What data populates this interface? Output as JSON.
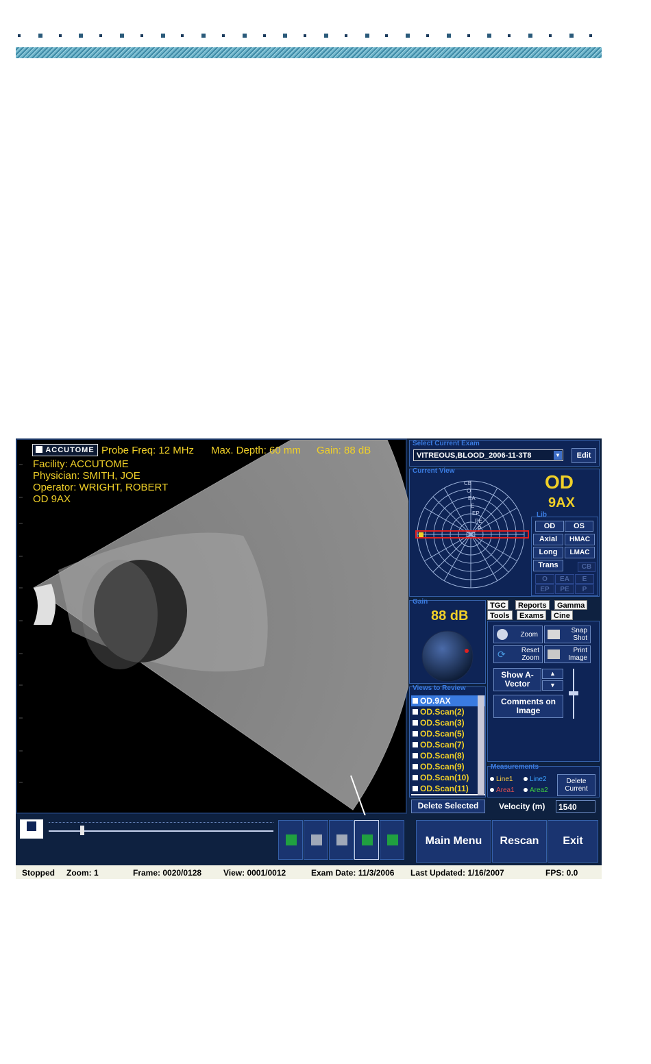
{
  "header": {
    "accent": "#4a9ab8"
  },
  "viewer": {
    "logo_text": "ACCUTOME",
    "probe_freq": "Probe Freq: 12 MHz",
    "max_depth": "Max. Depth: 60 mm",
    "gain": "Gain: 88 dB",
    "facility": "Facility: ACCUTOME",
    "physician": "Physician: SMITH, JOE",
    "operator": "Operator: WRIGHT, ROBERT",
    "view_label": "OD  9AX",
    "text_color": "#f0d028"
  },
  "exam": {
    "legend": "Select Current Exam",
    "selected": "VITREOUS,BLOOD_2006-11-3T8",
    "edit_label": "Edit"
  },
  "current_view": {
    "legend": "Current View",
    "eye": "OD",
    "view": "9AX",
    "polar_labels": [
      "CB",
      "O",
      "EA",
      "E",
      "EP",
      "PE",
      "P"
    ],
    "lib_legend": "Lib",
    "buttons": [
      "OD",
      "OS",
      "Axial",
      "HMAC",
      "Long",
      "LMAC",
      "Trans",
      "CB",
      "O",
      "EA",
      "E",
      "EP",
      "PE",
      "P"
    ]
  },
  "gain_panel": {
    "legend": "Gain",
    "value": "88 dB"
  },
  "tabs": {
    "row1": [
      "TGC",
      "Reports",
      "Gamma"
    ],
    "row2": [
      "Tools",
      "Exams",
      "Cine"
    ],
    "active": "Tools"
  },
  "tools": {
    "zoom": "Zoom",
    "snap_shot": "Snap Shot",
    "reset_zoom": "Reset Zoom",
    "print_image": "Print Image",
    "show_a_vector": "Show A-Vector",
    "comments": "Comments on Image"
  },
  "views": {
    "legend": "Views to Review",
    "items": [
      "OD.9AX",
      "OD.Scan(2)",
      "OD.Scan(3)",
      "OD.Scan(5)",
      "OD.Scan(7)",
      "OD.Scan(8)",
      "OD.Scan(9)",
      "OD.Scan(10)",
      "OD.Scan(11)"
    ],
    "selected_index": 0,
    "delete_label": "Delete Selected"
  },
  "measurements": {
    "legend": "Measurements",
    "line1": "Line1",
    "line2": "Line2",
    "area1": "Area1",
    "area2": "Area2",
    "delete_current": "Delete Current",
    "velocity_label": "Velocity (m)",
    "velocity_value": "1540",
    "colors": {
      "line1": "#ffd040",
      "line2": "#3aa0ff",
      "area1": "#e05050",
      "area2": "#40d040"
    }
  },
  "cine": {
    "slider_position": 0.15
  },
  "actions": {
    "main_menu": "Main Menu",
    "rescan": "Rescan",
    "exit": "Exit"
  },
  "status": {
    "state": "Stopped",
    "zoom": "Zoom: 1",
    "frame": "Frame: 0020/0128",
    "view": "View: 0001/0012",
    "exam_date": "Exam Date: 11/3/2006",
    "last_updated": "Last Updated: 1/16/2007",
    "fps": "FPS: 0.0"
  }
}
